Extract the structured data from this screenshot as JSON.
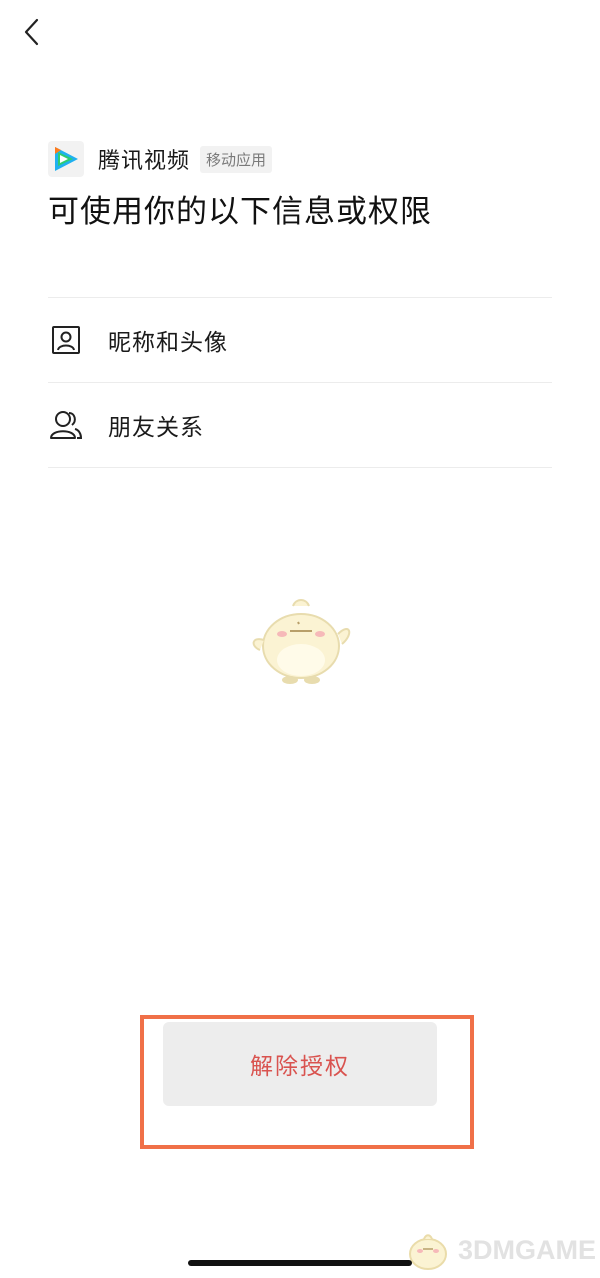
{
  "nav": {
    "back_icon": "chevron-left-icon"
  },
  "app": {
    "name": "腾讯视频",
    "tag": "移动应用",
    "logo_icon": "tencent-video-logo-icon",
    "logo_colors": [
      "#1fb0f0",
      "#ff7a1a",
      "#2dcc70"
    ]
  },
  "title": "可使用你的以下信息或权限",
  "permissions": [
    {
      "label": "昵称和头像",
      "icon": "id-card-icon"
    },
    {
      "label": "朋友关系",
      "icon": "friends-icon"
    }
  ],
  "actions": {
    "revoke_label": "解除授权"
  },
  "watermark": {
    "text": "3DMGAME"
  },
  "colors": {
    "revoke_text": "#d9534f",
    "highlight_border": "#f07048",
    "button_bg": "#ededed",
    "divider": "#ececec"
  }
}
